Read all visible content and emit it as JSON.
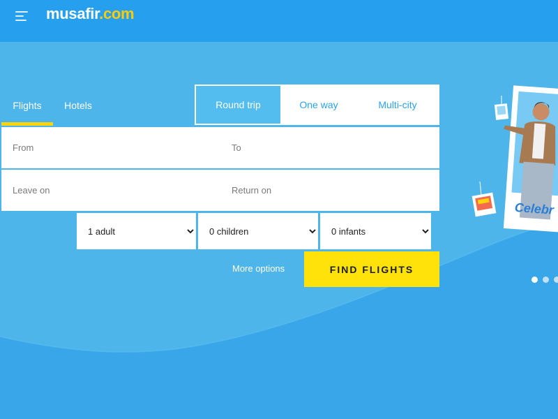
{
  "brand": {
    "name": "musafir",
    "tld": ".com"
  },
  "tabs": [
    {
      "label": "Flights",
      "active": true
    },
    {
      "label": "Hotels",
      "active": false
    }
  ],
  "trip_types": [
    {
      "label": "Round trip",
      "active": true
    },
    {
      "label": "One way",
      "active": false
    },
    {
      "label": "Multi-city",
      "active": false
    }
  ],
  "search": {
    "from_placeholder": "From",
    "to_placeholder": "To",
    "leave_placeholder": "Leave on",
    "return_placeholder": "Return on"
  },
  "passengers": {
    "adults": "1 adult",
    "children": "0 children",
    "infants": "0 infants"
  },
  "more_options_label": "More options",
  "find_flights_label": "FIND FLIGHTS",
  "promo": {
    "text": "Celebr"
  },
  "carousel": {
    "count": 3,
    "active_index": 0
  },
  "colors": {
    "header": "#26a0ee",
    "accent": "#ffd30a",
    "button": "#ffe20a"
  }
}
